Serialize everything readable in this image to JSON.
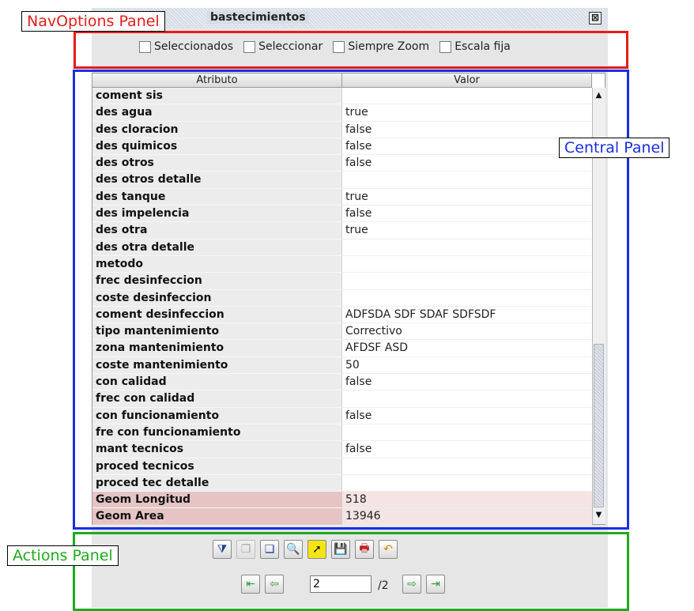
{
  "window": {
    "title": "bastecimientos",
    "close_glyph": "⊠"
  },
  "nav_options": {
    "checkboxes": [
      {
        "label": "Seleccionados",
        "checked": false
      },
      {
        "label": "Seleccionar",
        "checked": false
      },
      {
        "label": "Siempre Zoom",
        "checked": false
      },
      {
        "label": "Escala fija",
        "checked": false
      }
    ]
  },
  "table": {
    "headers": [
      "Atributo",
      "Valor"
    ],
    "rows": [
      {
        "attr": "coment sis",
        "value": ""
      },
      {
        "attr": "des agua",
        "value": "true"
      },
      {
        "attr": "des cloracion",
        "value": "false"
      },
      {
        "attr": "des quimicos",
        "value": "false"
      },
      {
        "attr": "des otros",
        "value": "false"
      },
      {
        "attr": "des otros detalle",
        "value": ""
      },
      {
        "attr": "des tanque",
        "value": "true"
      },
      {
        "attr": "des impelencia",
        "value": "false"
      },
      {
        "attr": "des otra",
        "value": "true"
      },
      {
        "attr": "des otra detalle",
        "value": ""
      },
      {
        "attr": "metodo",
        "value": ""
      },
      {
        "attr": "frec desinfeccion",
        "value": ""
      },
      {
        "attr": "coste desinfeccion",
        "value": ""
      },
      {
        "attr": "coment desinfeccion",
        "value": "ADFSDA SDF SDAF SDFSDF"
      },
      {
        "attr": "tipo mantenimiento",
        "value": "Correctivo"
      },
      {
        "attr": "zona mantenimiento",
        "value": "AFDSF ASD"
      },
      {
        "attr": "coste mantenimiento",
        "value": "50"
      },
      {
        "attr": "con calidad",
        "value": "false"
      },
      {
        "attr": "frec con calidad",
        "value": ""
      },
      {
        "attr": "con funcionamiento",
        "value": "false"
      },
      {
        "attr": "fre con funcionamiento",
        "value": ""
      },
      {
        "attr": "mant tecnicos",
        "value": "false"
      },
      {
        "attr": "proced tecnicos",
        "value": ""
      },
      {
        "attr": "proced tec detalle",
        "value": ""
      },
      {
        "attr": "Geom Longitud",
        "value": "518",
        "geom": true
      },
      {
        "attr": "Geom Area",
        "value": "13946",
        "geom": true
      }
    ]
  },
  "actions": {
    "toolbar": [
      {
        "name": "filter-icon",
        "glyph": "⧩",
        "enabled": true
      },
      {
        "name": "copy-icon",
        "glyph": "❐",
        "enabled": false
      },
      {
        "name": "copy-all-icon",
        "glyph": "❏",
        "enabled": true
      },
      {
        "name": "zoom-icon",
        "glyph": "🔍",
        "enabled": true
      },
      {
        "name": "select-cursor-icon",
        "glyph": "➚",
        "enabled": true
      },
      {
        "name": "save-icon",
        "glyph": "💾",
        "enabled": true
      },
      {
        "name": "print-icon",
        "glyph": "🖶",
        "enabled": true
      },
      {
        "name": "undo-icon",
        "glyph": "↶",
        "enabled": true
      }
    ],
    "pager": {
      "first_glyph": "⇤",
      "prev_glyph": "⇦",
      "next_glyph": "⇨",
      "last_glyph": "⇥",
      "current": "2",
      "total_label": "/2"
    }
  },
  "annotations": {
    "nav_label": "NavOptions Panel",
    "central_label": "Central Panel",
    "actions_label": "Actions Panel",
    "colors": {
      "nav": "#e51c1c",
      "central": "#1a2fe0",
      "actions": "#1faa1f"
    }
  }
}
